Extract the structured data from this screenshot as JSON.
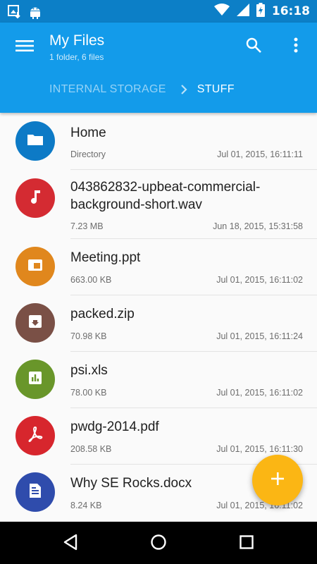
{
  "status_bar": {
    "time": "16:18",
    "left_icons": [
      "photo-download-icon",
      "android-icon"
    ],
    "right_icons": [
      "wifi-icon",
      "signal-icon",
      "battery-charging-icon"
    ]
  },
  "app_bar": {
    "title": "My Files",
    "subtitle": "1 folder, 6 files",
    "breadcrumb": {
      "root": "INTERNAL STORAGE",
      "current": "STUFF"
    },
    "colors": {
      "primary": "#139bea",
      "status": "#0c7fc7"
    }
  },
  "files": [
    {
      "name": "Home",
      "meta": "Directory",
      "date": "Jul 01, 2015, 16:11:11",
      "icon": "folder-icon",
      "color": "#0d7ac6"
    },
    {
      "name": "043862832-upbeat-commercial-background-short.wav",
      "meta": "7.23 MB",
      "date": "Jun 18, 2015, 15:31:58",
      "icon": "music-note-icon",
      "color": "#d42b32"
    },
    {
      "name": "Meeting.ppt",
      "meta": "663.00 KB",
      "date": "Jul 01, 2015, 16:11:02",
      "icon": "presentation-icon",
      "color": "#e0871d"
    },
    {
      "name": "packed.zip",
      "meta": "70.98 KB",
      "date": "Jul 01, 2015, 16:11:24",
      "icon": "archive-icon",
      "color": "#7a5046"
    },
    {
      "name": "psi.xls",
      "meta": "78.00 KB",
      "date": "Jul 01, 2015, 16:11:02",
      "icon": "spreadsheet-icon",
      "color": "#69962a"
    },
    {
      "name": "pwdg-2014.pdf",
      "meta": "208.58 KB",
      "date": "Jul 01, 2015, 16:11:30",
      "icon": "pdf-icon",
      "color": "#d7262d"
    },
    {
      "name": "Why SE Rocks.docx",
      "meta": "8.24 KB",
      "date": "Jul 01, 2015, 16:11:02",
      "icon": "document-icon",
      "color": "#2f4cac"
    }
  ],
  "fab": {
    "icon": "add-icon",
    "color": "#fbb614"
  },
  "nav": {
    "icons": [
      "back-icon",
      "home-icon",
      "recents-icon"
    ]
  }
}
